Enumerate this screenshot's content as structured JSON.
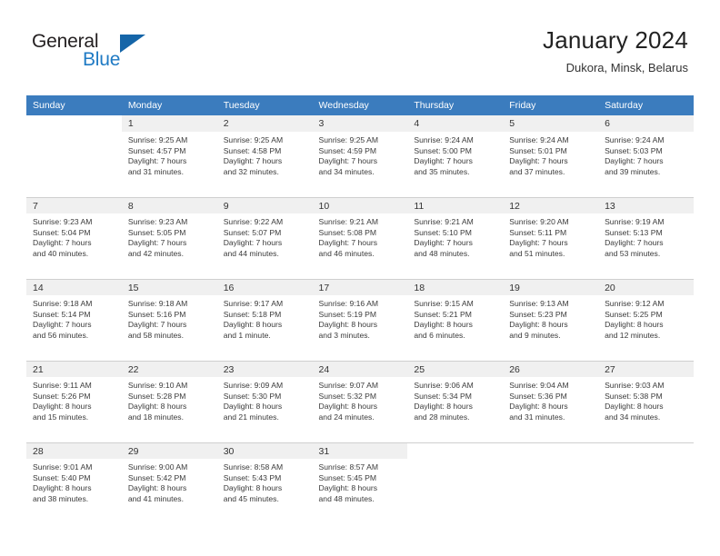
{
  "brand": {
    "name_part1": "General",
    "name_part2": "Blue",
    "triangle_color": "#1565a8",
    "blue_color": "#1f7ac4"
  },
  "header": {
    "title": "January 2024",
    "location": "Dukora, Minsk, Belarus"
  },
  "theme": {
    "header_row_bg": "#3b7cbe",
    "daynum_bg": "#f0f0f0",
    "grid_line": "#cfcfcf",
    "text": "#3a3a3a"
  },
  "weekday_headers": [
    "Sunday",
    "Monday",
    "Tuesday",
    "Wednesday",
    "Thursday",
    "Friday",
    "Saturday"
  ],
  "labels": {
    "sunrise_prefix": "Sunrise:",
    "sunset_prefix": "Sunset:",
    "daylight_prefix": "Daylight:"
  },
  "weeks": [
    [
      {
        "empty": true,
        "day": "",
        "sunrise": "",
        "sunset": "",
        "daylight_line1": "",
        "daylight_line2": ""
      },
      {
        "empty": false,
        "day": "1",
        "sunrise": "Sunrise: 9:25 AM",
        "sunset": "Sunset: 4:57 PM",
        "daylight_line1": "Daylight: 7 hours",
        "daylight_line2": "and 31 minutes."
      },
      {
        "empty": false,
        "day": "2",
        "sunrise": "Sunrise: 9:25 AM",
        "sunset": "Sunset: 4:58 PM",
        "daylight_line1": "Daylight: 7 hours",
        "daylight_line2": "and 32 minutes."
      },
      {
        "empty": false,
        "day": "3",
        "sunrise": "Sunrise: 9:25 AM",
        "sunset": "Sunset: 4:59 PM",
        "daylight_line1": "Daylight: 7 hours",
        "daylight_line2": "and 34 minutes."
      },
      {
        "empty": false,
        "day": "4",
        "sunrise": "Sunrise: 9:24 AM",
        "sunset": "Sunset: 5:00 PM",
        "daylight_line1": "Daylight: 7 hours",
        "daylight_line2": "and 35 minutes."
      },
      {
        "empty": false,
        "day": "5",
        "sunrise": "Sunrise: 9:24 AM",
        "sunset": "Sunset: 5:01 PM",
        "daylight_line1": "Daylight: 7 hours",
        "daylight_line2": "and 37 minutes."
      },
      {
        "empty": false,
        "day": "6",
        "sunrise": "Sunrise: 9:24 AM",
        "sunset": "Sunset: 5:03 PM",
        "daylight_line1": "Daylight: 7 hours",
        "daylight_line2": "and 39 minutes."
      }
    ],
    [
      {
        "empty": false,
        "day": "7",
        "sunrise": "Sunrise: 9:23 AM",
        "sunset": "Sunset: 5:04 PM",
        "daylight_line1": "Daylight: 7 hours",
        "daylight_line2": "and 40 minutes."
      },
      {
        "empty": false,
        "day": "8",
        "sunrise": "Sunrise: 9:23 AM",
        "sunset": "Sunset: 5:05 PM",
        "daylight_line1": "Daylight: 7 hours",
        "daylight_line2": "and 42 minutes."
      },
      {
        "empty": false,
        "day": "9",
        "sunrise": "Sunrise: 9:22 AM",
        "sunset": "Sunset: 5:07 PM",
        "daylight_line1": "Daylight: 7 hours",
        "daylight_line2": "and 44 minutes."
      },
      {
        "empty": false,
        "day": "10",
        "sunrise": "Sunrise: 9:21 AM",
        "sunset": "Sunset: 5:08 PM",
        "daylight_line1": "Daylight: 7 hours",
        "daylight_line2": "and 46 minutes."
      },
      {
        "empty": false,
        "day": "11",
        "sunrise": "Sunrise: 9:21 AM",
        "sunset": "Sunset: 5:10 PM",
        "daylight_line1": "Daylight: 7 hours",
        "daylight_line2": "and 48 minutes."
      },
      {
        "empty": false,
        "day": "12",
        "sunrise": "Sunrise: 9:20 AM",
        "sunset": "Sunset: 5:11 PM",
        "daylight_line1": "Daylight: 7 hours",
        "daylight_line2": "and 51 minutes."
      },
      {
        "empty": false,
        "day": "13",
        "sunrise": "Sunrise: 9:19 AM",
        "sunset": "Sunset: 5:13 PM",
        "daylight_line1": "Daylight: 7 hours",
        "daylight_line2": "and 53 minutes."
      }
    ],
    [
      {
        "empty": false,
        "day": "14",
        "sunrise": "Sunrise: 9:18 AM",
        "sunset": "Sunset: 5:14 PM",
        "daylight_line1": "Daylight: 7 hours",
        "daylight_line2": "and 56 minutes."
      },
      {
        "empty": false,
        "day": "15",
        "sunrise": "Sunrise: 9:18 AM",
        "sunset": "Sunset: 5:16 PM",
        "daylight_line1": "Daylight: 7 hours",
        "daylight_line2": "and 58 minutes."
      },
      {
        "empty": false,
        "day": "16",
        "sunrise": "Sunrise: 9:17 AM",
        "sunset": "Sunset: 5:18 PM",
        "daylight_line1": "Daylight: 8 hours",
        "daylight_line2": "and 1 minute."
      },
      {
        "empty": false,
        "day": "17",
        "sunrise": "Sunrise: 9:16 AM",
        "sunset": "Sunset: 5:19 PM",
        "daylight_line1": "Daylight: 8 hours",
        "daylight_line2": "and 3 minutes."
      },
      {
        "empty": false,
        "day": "18",
        "sunrise": "Sunrise: 9:15 AM",
        "sunset": "Sunset: 5:21 PM",
        "daylight_line1": "Daylight: 8 hours",
        "daylight_line2": "and 6 minutes."
      },
      {
        "empty": false,
        "day": "19",
        "sunrise": "Sunrise: 9:13 AM",
        "sunset": "Sunset: 5:23 PM",
        "daylight_line1": "Daylight: 8 hours",
        "daylight_line2": "and 9 minutes."
      },
      {
        "empty": false,
        "day": "20",
        "sunrise": "Sunrise: 9:12 AM",
        "sunset": "Sunset: 5:25 PM",
        "daylight_line1": "Daylight: 8 hours",
        "daylight_line2": "and 12 minutes."
      }
    ],
    [
      {
        "empty": false,
        "day": "21",
        "sunrise": "Sunrise: 9:11 AM",
        "sunset": "Sunset: 5:26 PM",
        "daylight_line1": "Daylight: 8 hours",
        "daylight_line2": "and 15 minutes."
      },
      {
        "empty": false,
        "day": "22",
        "sunrise": "Sunrise: 9:10 AM",
        "sunset": "Sunset: 5:28 PM",
        "daylight_line1": "Daylight: 8 hours",
        "daylight_line2": "and 18 minutes."
      },
      {
        "empty": false,
        "day": "23",
        "sunrise": "Sunrise: 9:09 AM",
        "sunset": "Sunset: 5:30 PM",
        "daylight_line1": "Daylight: 8 hours",
        "daylight_line2": "and 21 minutes."
      },
      {
        "empty": false,
        "day": "24",
        "sunrise": "Sunrise: 9:07 AM",
        "sunset": "Sunset: 5:32 PM",
        "daylight_line1": "Daylight: 8 hours",
        "daylight_line2": "and 24 minutes."
      },
      {
        "empty": false,
        "day": "25",
        "sunrise": "Sunrise: 9:06 AM",
        "sunset": "Sunset: 5:34 PM",
        "daylight_line1": "Daylight: 8 hours",
        "daylight_line2": "and 28 minutes."
      },
      {
        "empty": false,
        "day": "26",
        "sunrise": "Sunrise: 9:04 AM",
        "sunset": "Sunset: 5:36 PM",
        "daylight_line1": "Daylight: 8 hours",
        "daylight_line2": "and 31 minutes."
      },
      {
        "empty": false,
        "day": "27",
        "sunrise": "Sunrise: 9:03 AM",
        "sunset": "Sunset: 5:38 PM",
        "daylight_line1": "Daylight: 8 hours",
        "daylight_line2": "and 34 minutes."
      }
    ],
    [
      {
        "empty": false,
        "day": "28",
        "sunrise": "Sunrise: 9:01 AM",
        "sunset": "Sunset: 5:40 PM",
        "daylight_line1": "Daylight: 8 hours",
        "daylight_line2": "and 38 minutes."
      },
      {
        "empty": false,
        "day": "29",
        "sunrise": "Sunrise: 9:00 AM",
        "sunset": "Sunset: 5:42 PM",
        "daylight_line1": "Daylight: 8 hours",
        "daylight_line2": "and 41 minutes."
      },
      {
        "empty": false,
        "day": "30",
        "sunrise": "Sunrise: 8:58 AM",
        "sunset": "Sunset: 5:43 PM",
        "daylight_line1": "Daylight: 8 hours",
        "daylight_line2": "and 45 minutes."
      },
      {
        "empty": false,
        "day": "31",
        "sunrise": "Sunrise: 8:57 AM",
        "sunset": "Sunset: 5:45 PM",
        "daylight_line1": "Daylight: 8 hours",
        "daylight_line2": "and 48 minutes."
      },
      {
        "empty": true,
        "day": "",
        "sunrise": "",
        "sunset": "",
        "daylight_line1": "",
        "daylight_line2": ""
      },
      {
        "empty": true,
        "day": "",
        "sunrise": "",
        "sunset": "",
        "daylight_line1": "",
        "daylight_line2": ""
      },
      {
        "empty": true,
        "day": "",
        "sunrise": "",
        "sunset": "",
        "daylight_line1": "",
        "daylight_line2": ""
      }
    ]
  ]
}
